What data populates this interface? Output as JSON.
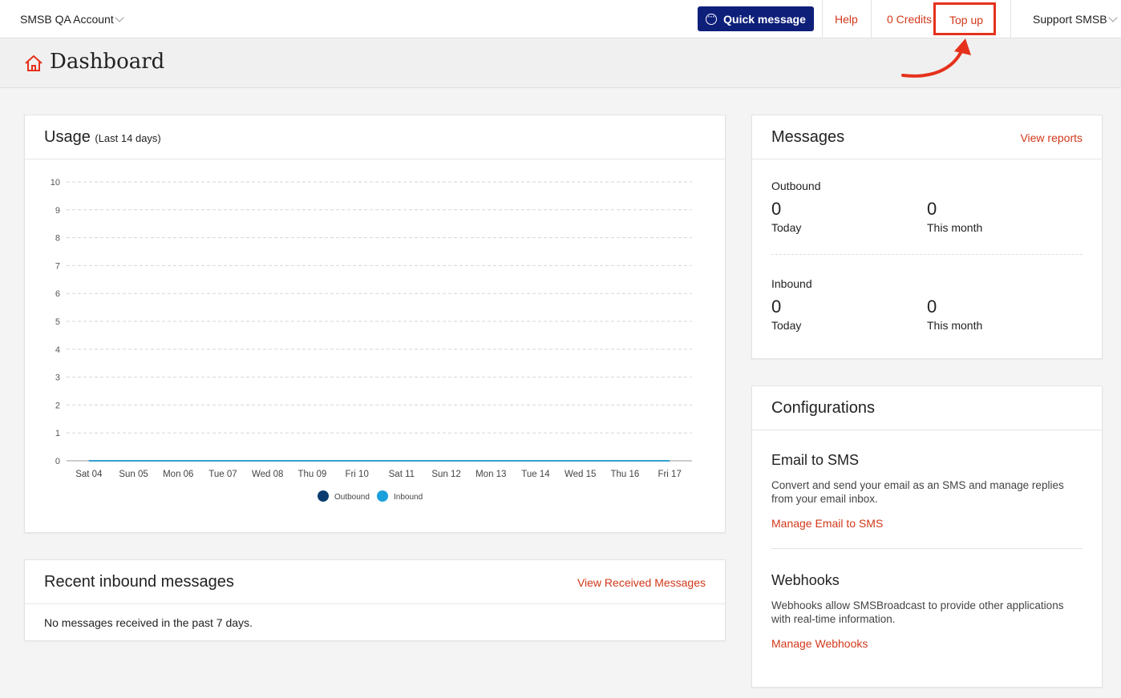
{
  "topbar": {
    "account": "SMSB QA Account",
    "quick_message": "Quick message",
    "help": "Help",
    "credits": "0 Credits",
    "top_up": "Top up",
    "support": "Support SMSB"
  },
  "page": {
    "title": "Dashboard"
  },
  "usage": {
    "title": "Usage",
    "subtitle": "(Last 14 days)"
  },
  "chart_data": {
    "type": "line",
    "categories": [
      "Sat 04",
      "Sun 05",
      "Mon 06",
      "Tue 07",
      "Wed 08",
      "Thu 09",
      "Fri 10",
      "Sat 11",
      "Sun 12",
      "Mon 13",
      "Tue 14",
      "Wed 15",
      "Thu 16",
      "Fri 17"
    ],
    "series": [
      {
        "name": "Outbound",
        "values": [
          0,
          0,
          0,
          0,
          0,
          0,
          0,
          0,
          0,
          0,
          0,
          0,
          0,
          0
        ],
        "color": "#0a3d6e"
      },
      {
        "name": "Inbound",
        "values": [
          0,
          0,
          0,
          0,
          0,
          0,
          0,
          0,
          0,
          0,
          0,
          0,
          0,
          0
        ],
        "color": "#1aa0dc"
      }
    ],
    "yticks": [
      0,
      1,
      2,
      3,
      4,
      5,
      6,
      7,
      8,
      9,
      10
    ],
    "ylim": [
      0,
      10
    ],
    "grid": true,
    "legend": "bottom-center"
  },
  "recent_inbound": {
    "title": "Recent inbound messages",
    "link": "View Received Messages",
    "empty": "No messages received in the past 7 days."
  },
  "messages": {
    "title": "Messages",
    "link": "View reports",
    "outbound": {
      "label": "Outbound",
      "today_value": "0",
      "today_label": "Today",
      "month_value": "0",
      "month_label": "This month"
    },
    "inbound": {
      "label": "Inbound",
      "today_value": "0",
      "today_label": "Today",
      "month_value": "0",
      "month_label": "This month"
    }
  },
  "configurations": {
    "title": "Configurations",
    "email": {
      "title": "Email to SMS",
      "desc": "Convert and send your email as an SMS and manage replies from your email inbox.",
      "link": "Manage Email to SMS"
    },
    "webhooks": {
      "title": "Webhooks",
      "desc": "Webhooks allow SMSBroadcast to provide other applications with real-time information.",
      "link": "Manage Webhooks"
    }
  },
  "colors": {
    "accent": "#d2381a",
    "primary_button": "#0e1f7a",
    "highlight": "#e5311c"
  }
}
